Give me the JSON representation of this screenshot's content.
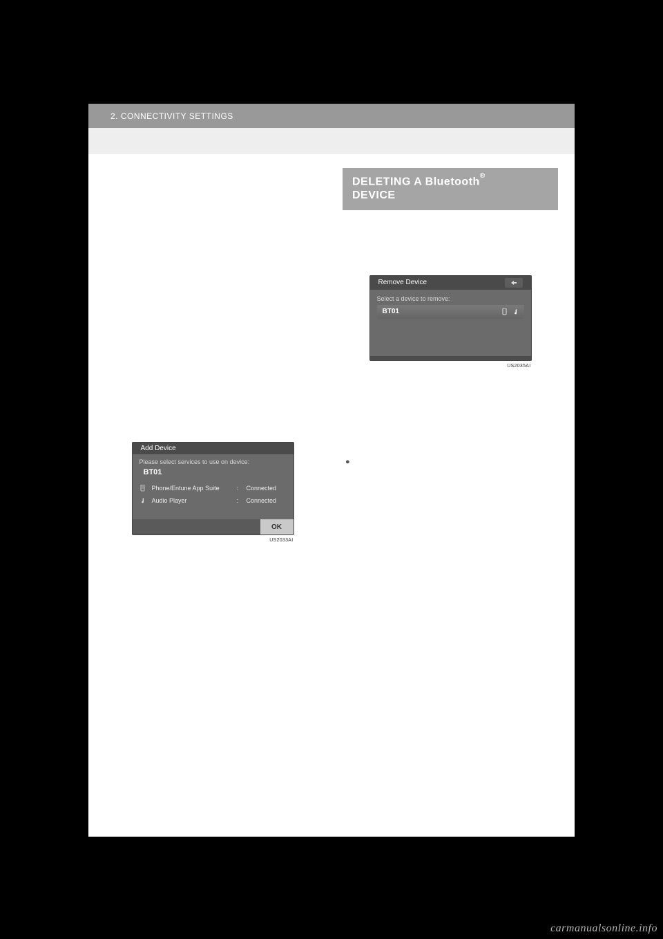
{
  "header": {
    "breadcrumb": "2. CONNECTIVITY SETTINGS"
  },
  "right": {
    "section_title_pre": "DELETING A Bluetooth",
    "section_title_sup": "®",
    "section_title_post": "DEVICE",
    "screen": {
      "tab_title": "Remove Device",
      "prompt": "Select a device to remove:",
      "device": "BT01",
      "imgid": "US2035AI"
    }
  },
  "left": {
    "screen": {
      "tab_title": "Add Device",
      "prompt": "Please select services to use on device:",
      "device": "BT01",
      "rows": [
        {
          "label": "Phone/Entune App Suite",
          "status": "Connected"
        },
        {
          "label": "Audio Player",
          "status": "Connected"
        }
      ],
      "ok": "OK",
      "imgid": "US2033AI"
    }
  },
  "watermark": "carmanualsonline.info",
  "bullet": "●"
}
